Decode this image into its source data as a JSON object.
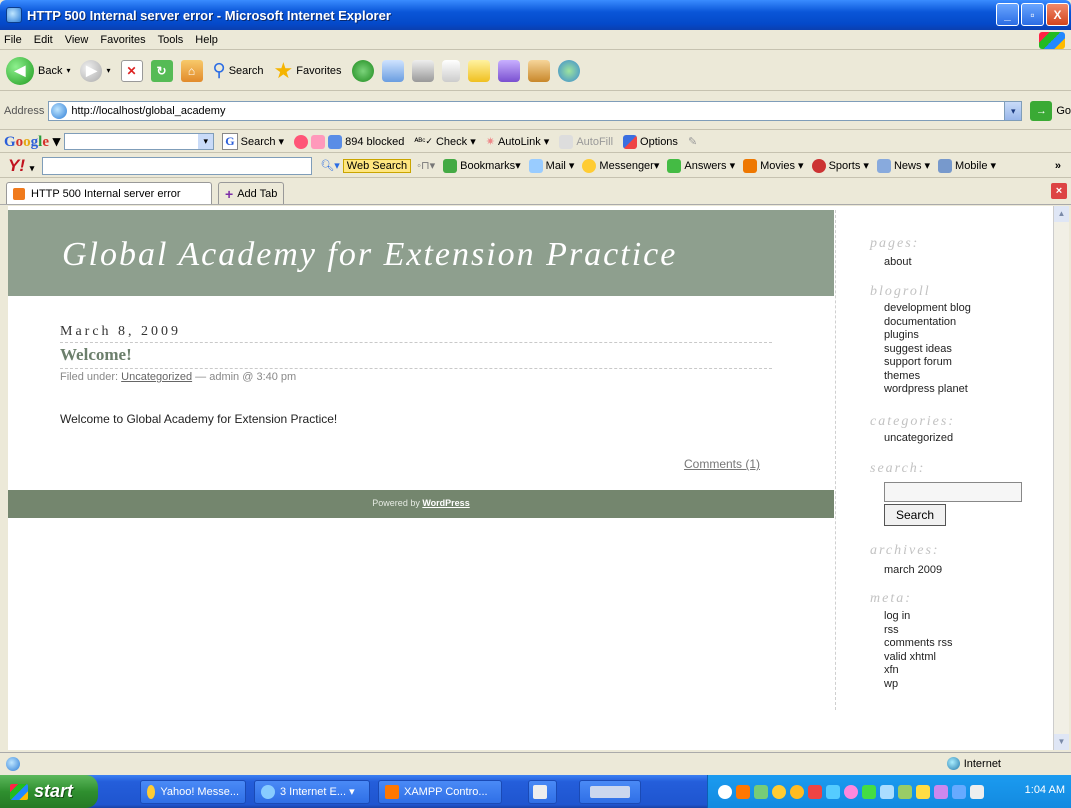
{
  "window": {
    "title": "HTTP 500 Internal server error - Microsoft Internet Explorer",
    "buttons": {
      "minimize": "_",
      "maximize": "▫",
      "close": "X"
    }
  },
  "menu": [
    "File",
    "Edit",
    "View",
    "Favorites",
    "Tools",
    "Help"
  ],
  "toolbar": {
    "back": "Back",
    "search": "Search",
    "favorites": "Favorites"
  },
  "address": {
    "label": "Address",
    "url": "http://localhost/global_academy",
    "go": "Go"
  },
  "google_bar": {
    "logo": {
      "g1": "G",
      "o1": "o",
      "o2": "o",
      "g2": "g",
      "l": "l",
      "e": "e"
    },
    "search": "Search",
    "blocked": "894 blocked",
    "check": "Check",
    "autolink": "AutoLink",
    "autofill": "AutoFill",
    "options": "Options"
  },
  "yahoo_bar": {
    "logo": "Y!",
    "web_search": "Web Search",
    "items": [
      "Bookmarks",
      "Mail",
      "Messenger",
      "Answers",
      "Movies",
      "Sports",
      "News",
      "Mobile"
    ],
    "more": "»"
  },
  "tabs": {
    "active": "HTTP 500 Internal server error",
    "add": "Add Tab"
  },
  "page": {
    "site_title": "Global Academy for Extension Practice",
    "post": {
      "date": "March 8, 2009",
      "title": "Welcome!",
      "meta_prefix": "Filed under:",
      "category": "Uncategorized",
      "meta_suffix": "— admin @ 3:40 pm",
      "body": "Welcome to Global Academy for Extension Practice!",
      "comments": "Comments (1)"
    },
    "footer": {
      "prefix": "Powered by",
      "link": "WordPress"
    },
    "sidebar": {
      "pages_head": "pages:",
      "pages": [
        "about"
      ],
      "blogroll_head": "blogroll",
      "blogroll": [
        "development blog",
        "documentation",
        "plugins",
        "suggest ideas",
        "support forum",
        "themes",
        "wordpress planet"
      ],
      "categories_head": "categories:",
      "categories": [
        "uncategorized"
      ],
      "search_head": "search:",
      "search_button": "Search",
      "archives_head": "archives:",
      "archives": [
        "march 2009"
      ],
      "meta_head": "meta:",
      "meta": [
        "log in",
        "rss",
        "comments rss",
        "valid xhtml",
        "xfn",
        "wp"
      ]
    }
  },
  "status": {
    "zone": "Internet"
  },
  "taskbar": {
    "start": "start",
    "tasks": [
      "Yahoo! Messe...",
      "3 Internet E...",
      "XAMPP Contro..."
    ],
    "clock": "1:04 AM"
  }
}
